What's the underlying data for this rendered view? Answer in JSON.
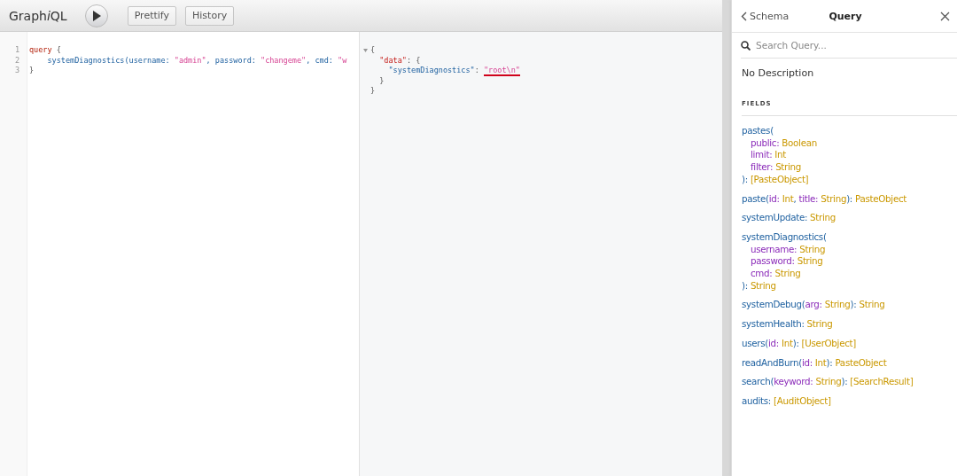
{
  "toolbar": {
    "title": "Graph",
    "title_italic": "i",
    "title_end": "QL",
    "buttons": [
      "Prettify",
      "History"
    ]
  },
  "query_editor": {
    "lines": [
      {
        "number": "1",
        "tokens": [
          {
            "kind": "keyword",
            "text": "query"
          },
          {
            "kind": "punct",
            "text": " {"
          }
        ]
      },
      {
        "number": "2",
        "tokens": [
          {
            "kind": "plain",
            "text": "    systemDiagnostics(username: "
          },
          {
            "kind": "string",
            "text": "\"admin\""
          },
          {
            "kind": "plain",
            "text": ", password: "
          },
          {
            "kind": "string",
            "text": "\"changeme\""
          },
          {
            "kind": "plain",
            "text": ", cmd: "
          },
          {
            "kind": "string",
            "text": "\"w"
          }
        ]
      },
      {
        "number": "3",
        "tokens": [
          {
            "kind": "punct",
            "text": "}"
          }
        ]
      }
    ]
  },
  "result": {
    "lines": [
      {
        "fold": true,
        "tokens": [
          {
            "kind": "punct",
            "text": "{"
          }
        ]
      },
      {
        "tokens": [
          {
            "kind": "property",
            "text": "  \"data\""
          },
          {
            "kind": "punct",
            "text": ": {"
          }
        ]
      },
      {
        "tokens": [
          {
            "kind": "key",
            "text": "    \"systemDiagnostics\""
          },
          {
            "kind": "punct",
            "text": ": "
          },
          {
            "kind": "result-string",
            "text": "\"root\\n\"",
            "underlined": true
          }
        ]
      },
      {
        "tokens": [
          {
            "kind": "punct",
            "text": "  }"
          }
        ]
      },
      {
        "tokens": [
          {
            "kind": "punct",
            "text": "}"
          }
        ]
      }
    ]
  },
  "docs": {
    "back": "Schema",
    "title": "Query",
    "search": {
      "placeholder": "Search Query..."
    },
    "description": "No Description",
    "section": "FIELDS",
    "fields": [
      {
        "lines": [
          {
            "indent": false,
            "tokens": [
              {
                "kind": "name",
                "text": "pastes("
              }
            ]
          },
          {
            "indent": true,
            "tokens": [
              {
                "kind": "arg",
                "text": "public: "
              },
              {
                "kind": "type",
                "text": "Boolean"
              }
            ]
          },
          {
            "indent": true,
            "tokens": [
              {
                "kind": "arg",
                "text": "limit: "
              },
              {
                "kind": "type",
                "text": "Int"
              }
            ]
          },
          {
            "indent": true,
            "tokens": [
              {
                "kind": "arg",
                "text": "filter: "
              },
              {
                "kind": "type",
                "text": "String"
              }
            ]
          },
          {
            "indent": false,
            "tokens": [
              {
                "kind": "name",
                "text": "): "
              },
              {
                "kind": "type",
                "text": "[PasteObject]"
              }
            ]
          }
        ]
      },
      {
        "lines": [
          {
            "indent": false,
            "tokens": [
              {
                "kind": "name",
                "text": "paste("
              },
              {
                "kind": "arg",
                "text": "id: "
              },
              {
                "kind": "type",
                "text": "Int"
              },
              {
                "kind": "name",
                "text": ", "
              },
              {
                "kind": "arg",
                "text": "title: "
              },
              {
                "kind": "type",
                "text": "String"
              },
              {
                "kind": "name",
                "text": "): "
              },
              {
                "kind": "type",
                "text": "PasteObject"
              }
            ]
          }
        ]
      },
      {
        "lines": [
          {
            "indent": false,
            "tokens": [
              {
                "kind": "name",
                "text": "systemUpdate: "
              },
              {
                "kind": "type",
                "text": "String"
              }
            ]
          }
        ]
      },
      {
        "lines": [
          {
            "indent": false,
            "tokens": [
              {
                "kind": "name",
                "text": "systemDiagnostics("
              }
            ]
          },
          {
            "indent": true,
            "tokens": [
              {
                "kind": "arg",
                "text": "username: "
              },
              {
                "kind": "type",
                "text": "String"
              }
            ]
          },
          {
            "indent": true,
            "tokens": [
              {
                "kind": "arg",
                "text": "password: "
              },
              {
                "kind": "type",
                "text": "String"
              }
            ]
          },
          {
            "indent": true,
            "tokens": [
              {
                "kind": "arg",
                "text": "cmd: "
              },
              {
                "kind": "type",
                "text": "String"
              }
            ]
          },
          {
            "indent": false,
            "tokens": [
              {
                "kind": "name",
                "text": "): "
              },
              {
                "kind": "type",
                "text": "String"
              }
            ]
          }
        ]
      },
      {
        "lines": [
          {
            "indent": false,
            "tokens": [
              {
                "kind": "name",
                "text": "systemDebug("
              },
              {
                "kind": "arg",
                "text": "arg: "
              },
              {
                "kind": "type",
                "text": "String"
              },
              {
                "kind": "name",
                "text": "): "
              },
              {
                "kind": "type",
                "text": "String"
              }
            ]
          }
        ]
      },
      {
        "lines": [
          {
            "indent": false,
            "tokens": [
              {
                "kind": "name",
                "text": "systemHealth: "
              },
              {
                "kind": "type",
                "text": "String"
              }
            ]
          }
        ]
      },
      {
        "lines": [
          {
            "indent": false,
            "tokens": [
              {
                "kind": "name",
                "text": "users("
              },
              {
                "kind": "arg",
                "text": "id: "
              },
              {
                "kind": "type",
                "text": "Int"
              },
              {
                "kind": "name",
                "text": "): "
              },
              {
                "kind": "type",
                "text": "[UserObject]"
              }
            ]
          }
        ]
      },
      {
        "lines": [
          {
            "indent": false,
            "tokens": [
              {
                "kind": "name",
                "text": "readAndBurn("
              },
              {
                "kind": "arg",
                "text": "id: "
              },
              {
                "kind": "type",
                "text": "Int"
              },
              {
                "kind": "name",
                "text": "): "
              },
              {
                "kind": "type",
                "text": "PasteObject"
              }
            ]
          }
        ]
      },
      {
        "lines": [
          {
            "indent": false,
            "tokens": [
              {
                "kind": "name",
                "text": "search("
              },
              {
                "kind": "arg",
                "text": "keyword: "
              },
              {
                "kind": "type",
                "text": "String"
              },
              {
                "kind": "name",
                "text": "): "
              },
              {
                "kind": "type",
                "text": "[SearchResult]"
              }
            ]
          }
        ]
      },
      {
        "lines": [
          {
            "indent": false,
            "tokens": [
              {
                "kind": "name",
                "text": "audits: "
              },
              {
                "kind": "type",
                "text": "[AuditObject]"
              }
            ]
          }
        ]
      }
    ]
  }
}
